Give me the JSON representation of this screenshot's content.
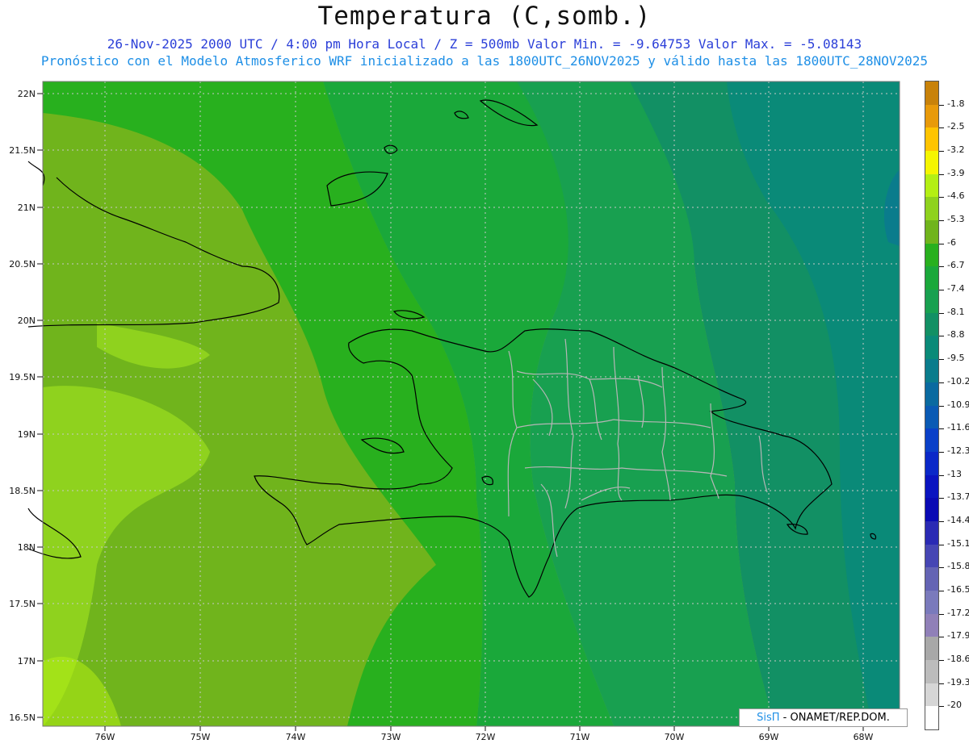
{
  "header": {
    "title": "Temperatura (C,somb.)",
    "line1": "26-Nov-2025  2000 UTC / 4:00 pm Hora Local / Z = 500mb  Valor Min. = -9.64753  Valor Max. = -5.08143",
    "line2": "Pronóstico con el Modelo Atmosferico WRF inicializado a las 1800UTC_26NOV2025 y válido hasta las  1800UTC_28NOV2025"
  },
  "axes": {
    "lat_labels": [
      "22N",
      "21.5N",
      "21N",
      "20.5N",
      "20N",
      "19.5N",
      "19N",
      "18.5N",
      "18N",
      "17.5N",
      "17N",
      "16.5N"
    ],
    "lon_labels": [
      "76W",
      "75W",
      "74W",
      "73W",
      "72W",
      "71W",
      "70W",
      "69W",
      "68W"
    ]
  },
  "legend": {
    "levels": [
      {
        "label": "-1.8",
        "color": "#c8820a"
      },
      {
        "label": "-2.5",
        "color": "#e89a0a"
      },
      {
        "label": "-3.2",
        "color": "#ffc400"
      },
      {
        "label": "-3.9",
        "color": "#f5f500"
      },
      {
        "label": "-4.6",
        "color": "#b4ef14"
      },
      {
        "label": "-5.3",
        "color": "#8fd21e"
      },
      {
        "label": "-6",
        "color": "#70b41c"
      },
      {
        "label": "-6.7",
        "color": "#28b01e"
      },
      {
        "label": "-7.4",
        "color": "#1aa83a"
      },
      {
        "label": "-8.1",
        "color": "#18a050"
      },
      {
        "label": "-8.8",
        "color": "#129064"
      },
      {
        "label": "-9.5",
        "color": "#0a8a78"
      },
      {
        "label": "-10.2",
        "color": "#0a7c8c"
      },
      {
        "label": "-10.9",
        "color": "#0a6aa0"
      },
      {
        "label": "-11.6",
        "color": "#0a5ab4"
      },
      {
        "label": "-12.3",
        "color": "#0a40c8"
      },
      {
        "label": "-13",
        "color": "#0a28c8"
      },
      {
        "label": "-13.7",
        "color": "#0a14c0"
      },
      {
        "label": "-14.4",
        "color": "#0a0ab4"
      },
      {
        "label": "-15.1",
        "color": "#2a2ab4"
      },
      {
        "label": "-15.8",
        "color": "#4646b4"
      },
      {
        "label": "-16.5",
        "color": "#6464b4"
      },
      {
        "label": "-17.2",
        "color": "#7a7abc"
      },
      {
        "label": "-17.9",
        "color": "#9080b8"
      },
      {
        "label": "-18.6",
        "color": "#a8a8a8"
      },
      {
        "label": "-19.3",
        "color": "#bcbcbc"
      },
      {
        "label": "-20",
        "color": "#d6d6d6"
      },
      {
        "label": "",
        "color": "#ffffff"
      }
    ]
  },
  "credit": {
    "brand": "SisΠ",
    "rest": " - ONAMET/REP.DOM."
  }
}
